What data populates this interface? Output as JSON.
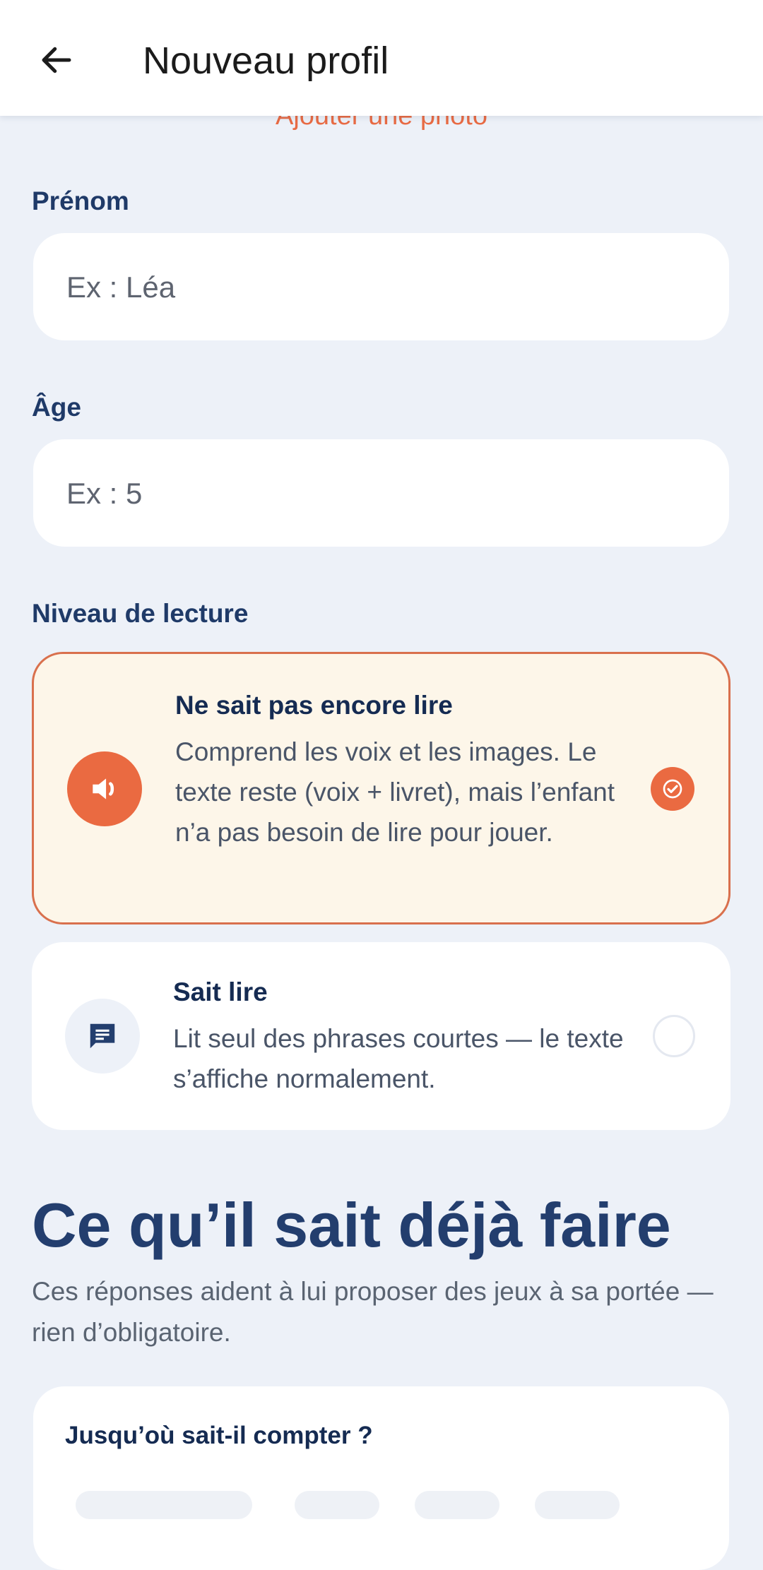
{
  "header": {
    "title": "Nouveau profil",
    "back_icon": "arrow-left-icon"
  },
  "photo_link": "Ajouter une photo",
  "first_name": {
    "label": "Prénom",
    "placeholder": "Ex : Léa"
  },
  "age": {
    "label": "Âge",
    "placeholder": "Ex : 5"
  },
  "reading_level": {
    "label": "Niveau de lecture",
    "options": [
      {
        "title": "Ne sait pas encore lire",
        "description": "Comprend les voix et les images. Le texte reste (voix + livret), mais l’enfant n’a pas besoin de lire pour jouer.",
        "icon": "speaker-icon",
        "selected": true
      },
      {
        "title": "Sait lire",
        "description": "Lit seul des phrases courtes — le texte s’affiche normalement.",
        "icon": "message-icon",
        "selected": false
      }
    ]
  },
  "skills_section": {
    "title": "Ce qu’il sait déjà faire",
    "subtitle": "Ces réponses aident à lui proposer des jeux à sa portée — rien d’obligatoire.",
    "card_title": "Jusqu’où sait-il compter ?"
  },
  "colors": {
    "accent": "#E8663F",
    "navy": "#1F3A68",
    "background": "#EDF1F8",
    "selected_card_bg": "#FDF6E9"
  }
}
